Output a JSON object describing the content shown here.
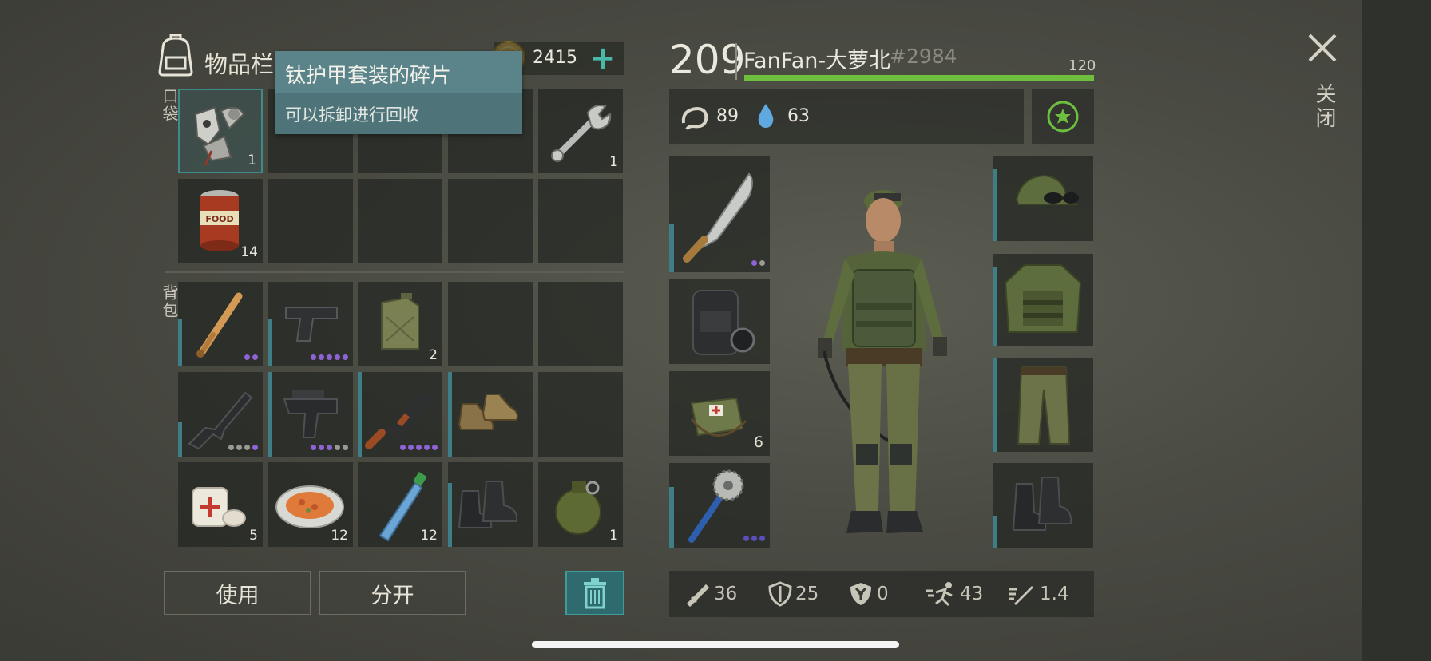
{
  "header": {
    "inventory_title": "物品栏",
    "coins": "2415",
    "level": "209",
    "player_name": "FanFan-大萝北",
    "player_id": "#2984",
    "hp": "120",
    "hp_fraction": 1.0
  },
  "tooltip": {
    "title": "钛护甲套装的碎片",
    "description": "可以拆卸进行回收"
  },
  "sections": {
    "pocket": "口袋",
    "backpack": "背包"
  },
  "status": {
    "hunger": "89",
    "thirst": "63"
  },
  "pocket_slots": [
    {
      "icon": "titanium-armor-fragments-icon",
      "count": "1"
    },
    {
      "icon": "",
      "count": ""
    },
    {
      "icon": "",
      "count": ""
    },
    {
      "icon": "",
      "count": ""
    },
    {
      "icon": "wrench-icon",
      "count": "1"
    },
    {
      "icon": "canned-food-icon",
      "count": "14"
    },
    {
      "icon": "",
      "count": ""
    },
    {
      "icon": "",
      "count": ""
    },
    {
      "icon": "",
      "count": ""
    },
    {
      "icon": "",
      "count": ""
    }
  ],
  "backpack_slots": [
    {
      "icon": "baseball-bat-icon",
      "count": ""
    },
    {
      "icon": "pistol-icon",
      "count": ""
    },
    {
      "icon": "jerrycan-icon",
      "count": "2"
    },
    {
      "icon": "",
      "count": ""
    },
    {
      "icon": "",
      "count": ""
    },
    {
      "icon": "assault-rifle-icon",
      "count": ""
    },
    {
      "icon": "uzi-icon",
      "count": ""
    },
    {
      "icon": "ak47-icon",
      "count": ""
    },
    {
      "icon": "brown-shoes-icon",
      "count": ""
    },
    {
      "icon": "",
      "count": ""
    },
    {
      "icon": "bandage-icon",
      "count": "5"
    },
    {
      "icon": "food-plate-icon",
      "count": "12"
    },
    {
      "icon": "water-bottle-icon",
      "count": "12"
    },
    {
      "icon": "black-boots-icon",
      "count": ""
    },
    {
      "icon": "grenade-icon",
      "count": "1"
    }
  ],
  "equipment_left": [
    {
      "icon": "machete-icon",
      "count": ""
    },
    {
      "icon": "backpack-icon",
      "count": ""
    },
    {
      "icon": "medkit-bag-icon",
      "count": "6"
    },
    {
      "icon": "saw-mace-icon",
      "count": ""
    }
  ],
  "equipment_right": [
    {
      "icon": "camo-cap-icon"
    },
    {
      "icon": "camo-vest-icon"
    },
    {
      "icon": "camo-pants-icon"
    },
    {
      "icon": "combat-boots-icon"
    }
  ],
  "stats": {
    "attack": "36",
    "defense": "25",
    "radiation": "0",
    "speed": "43",
    "attack_speed": "1.4"
  },
  "buttons": {
    "use": "使用",
    "split": "分开",
    "close": "关闭"
  },
  "colors": {
    "accent": "#3f7e86",
    "hp_bar": "#6fbf3f",
    "dot_purple": "#8f63d8",
    "dot_grey": "#9a9a95"
  }
}
